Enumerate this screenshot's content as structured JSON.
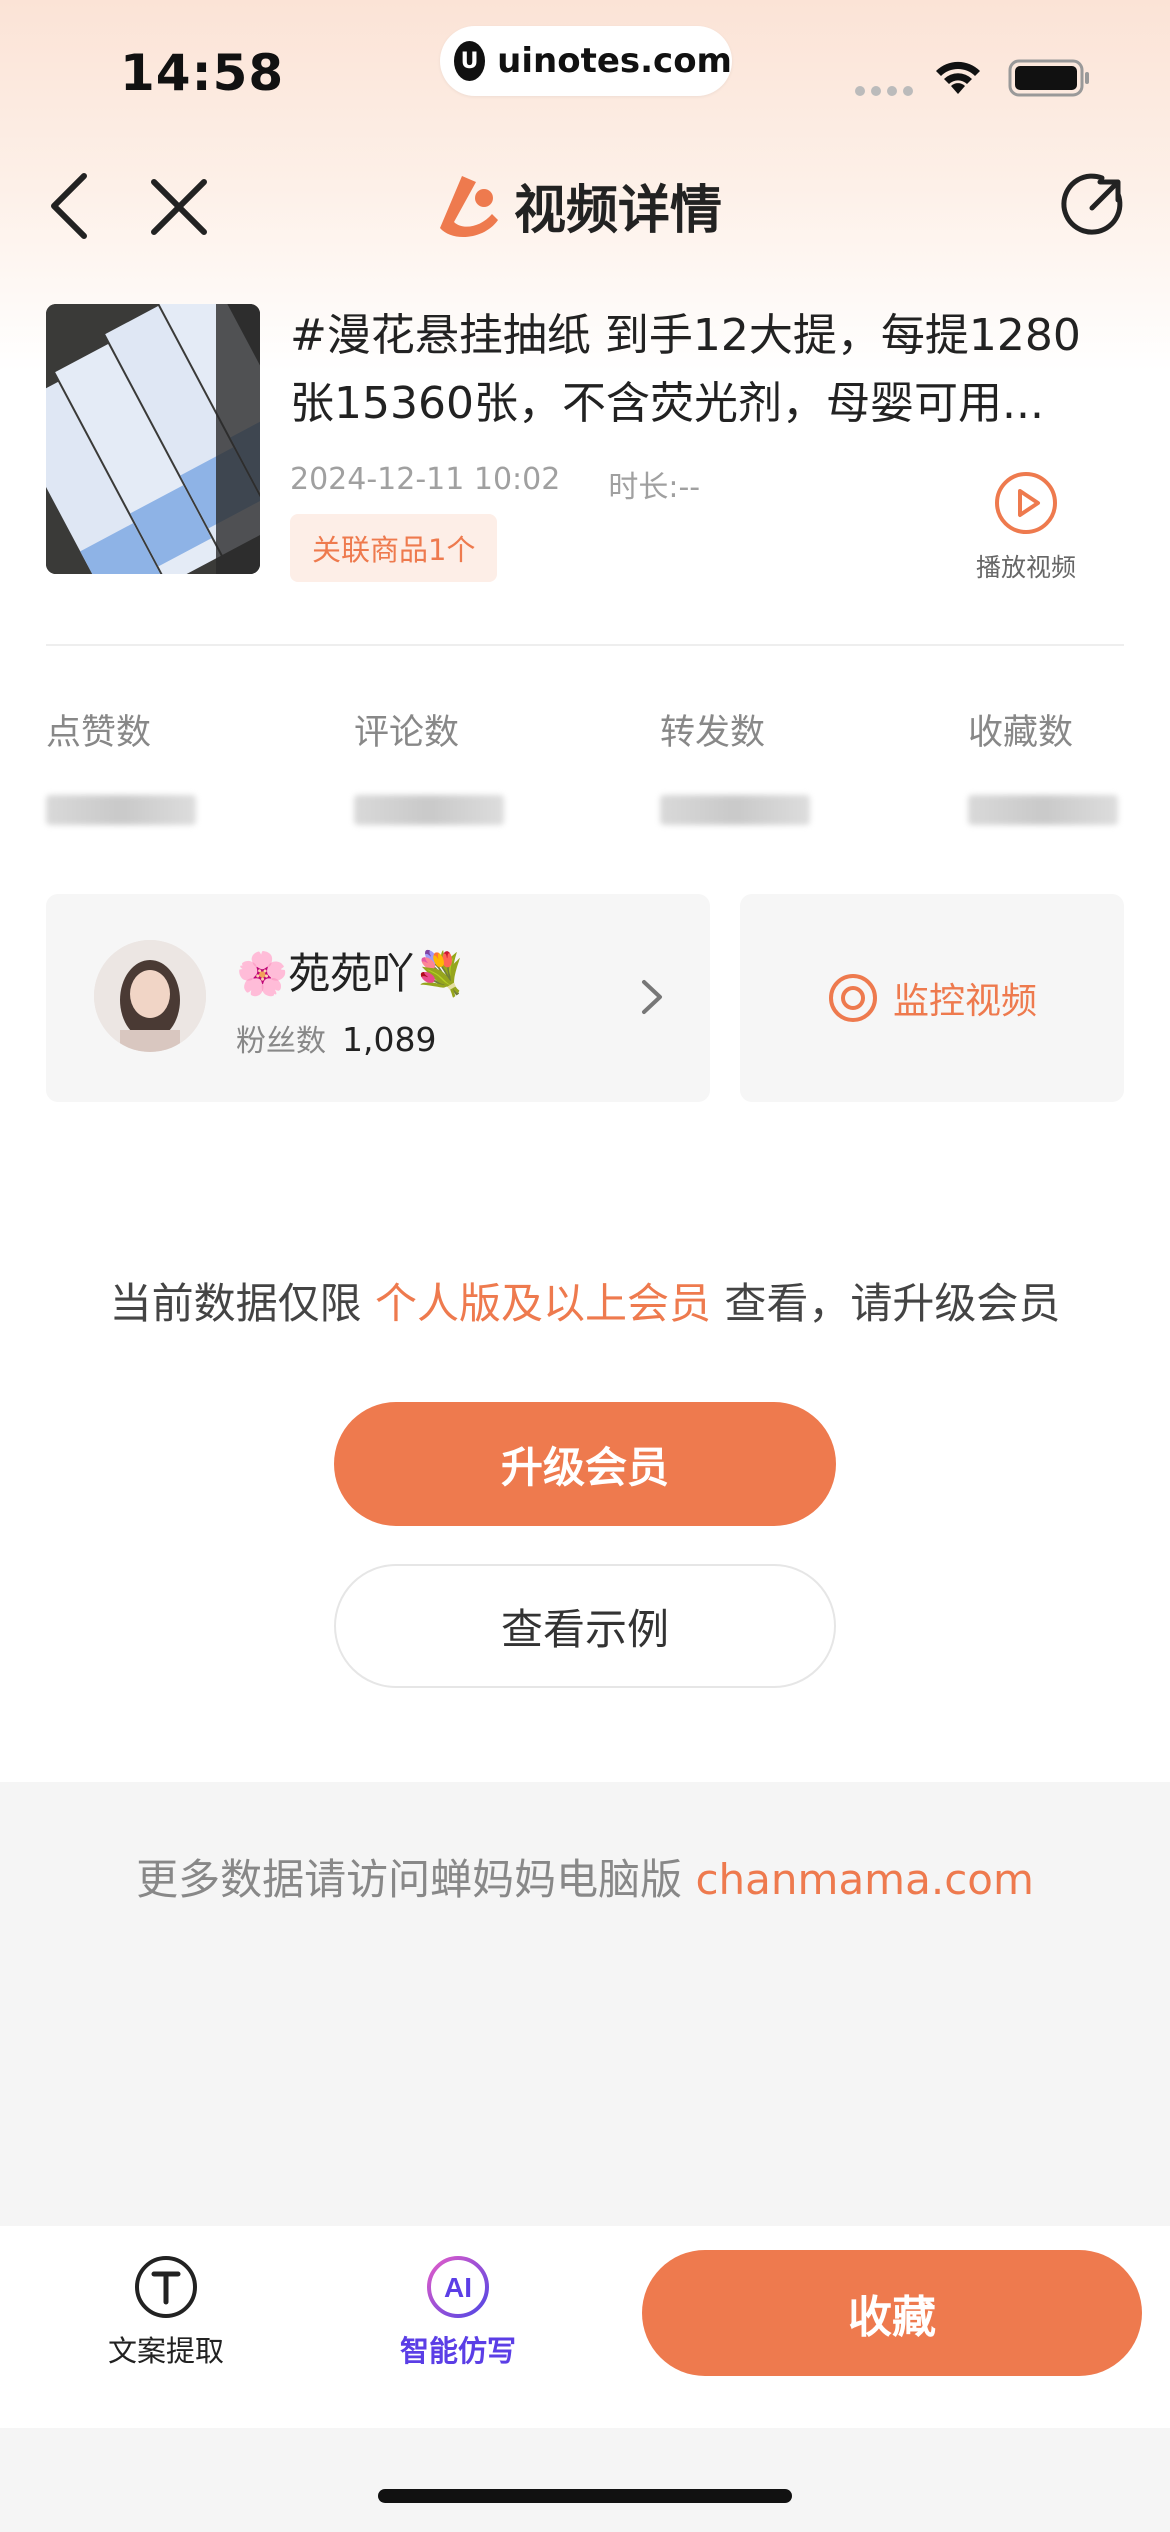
{
  "status_bar": {
    "time": "14:58",
    "url": "uinotes.com",
    "url_logo_icon": "uinotes-logo-icon"
  },
  "nav": {
    "title": "视频详情",
    "back_icon": "back-arrow-icon",
    "close_icon": "close-icon",
    "share_icon": "share-icon"
  },
  "video": {
    "title": "#漫花悬挂抽纸 到手12大提，每提1280张15360张，不含荧光剂，母婴可用...",
    "date": "2024-12-11 10:02",
    "duration": "时长:--",
    "goods_tag": "关联商品1个",
    "play_label": "播放视频"
  },
  "stats": [
    {
      "label": "点赞数"
    },
    {
      "label": "评论数"
    },
    {
      "label": "转发数"
    },
    {
      "label": "收藏数"
    }
  ],
  "author": {
    "name": "🌸苑苑吖💐",
    "fans_label": "粉丝数",
    "fans_value": "1,089"
  },
  "monitor": {
    "label": "监控视频"
  },
  "notice": {
    "prefix": "当前数据仅限",
    "highlight": "个人版及以上会员",
    "suffix": "查看，请升级会员",
    "upgrade_button": "升级会员",
    "example_button": "查看示例"
  },
  "more_data": {
    "text": "更多数据请访问蝉妈妈电脑版",
    "link": "chanmama.com"
  },
  "bottom_bar": {
    "copy_extract": "文案提取",
    "ai_rewrite": "智能仿写",
    "collect": "收藏"
  },
  "colors": {
    "accent": "#ee7a4e",
    "ai_purple": "#5b3ee6"
  }
}
